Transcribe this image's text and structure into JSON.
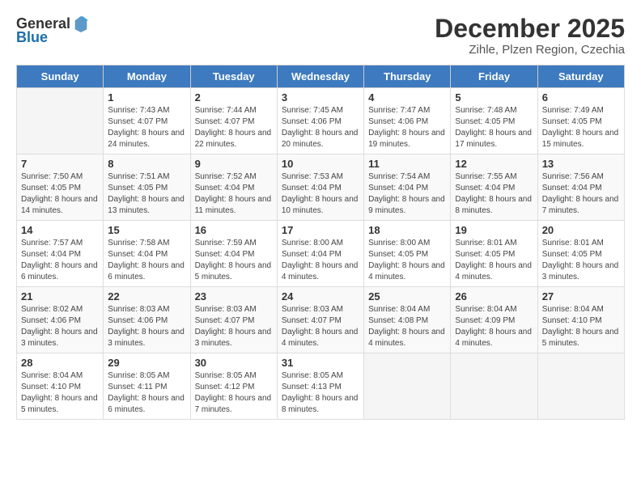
{
  "header": {
    "logo_general": "General",
    "logo_blue": "Blue",
    "month": "December 2025",
    "location": "Zihle, Plzen Region, Czechia"
  },
  "weekdays": [
    "Sunday",
    "Monday",
    "Tuesday",
    "Wednesday",
    "Thursday",
    "Friday",
    "Saturday"
  ],
  "weeks": [
    [
      {
        "day": "",
        "sunrise": "",
        "sunset": "",
        "daylight": ""
      },
      {
        "day": "1",
        "sunrise": "Sunrise: 7:43 AM",
        "sunset": "Sunset: 4:07 PM",
        "daylight": "Daylight: 8 hours and 24 minutes."
      },
      {
        "day": "2",
        "sunrise": "Sunrise: 7:44 AM",
        "sunset": "Sunset: 4:07 PM",
        "daylight": "Daylight: 8 hours and 22 minutes."
      },
      {
        "day": "3",
        "sunrise": "Sunrise: 7:45 AM",
        "sunset": "Sunset: 4:06 PM",
        "daylight": "Daylight: 8 hours and 20 minutes."
      },
      {
        "day": "4",
        "sunrise": "Sunrise: 7:47 AM",
        "sunset": "Sunset: 4:06 PM",
        "daylight": "Daylight: 8 hours and 19 minutes."
      },
      {
        "day": "5",
        "sunrise": "Sunrise: 7:48 AM",
        "sunset": "Sunset: 4:05 PM",
        "daylight": "Daylight: 8 hours and 17 minutes."
      },
      {
        "day": "6",
        "sunrise": "Sunrise: 7:49 AM",
        "sunset": "Sunset: 4:05 PM",
        "daylight": "Daylight: 8 hours and 15 minutes."
      }
    ],
    [
      {
        "day": "7",
        "sunrise": "Sunrise: 7:50 AM",
        "sunset": "Sunset: 4:05 PM",
        "daylight": "Daylight: 8 hours and 14 minutes."
      },
      {
        "day": "8",
        "sunrise": "Sunrise: 7:51 AM",
        "sunset": "Sunset: 4:05 PM",
        "daylight": "Daylight: 8 hours and 13 minutes."
      },
      {
        "day": "9",
        "sunrise": "Sunrise: 7:52 AM",
        "sunset": "Sunset: 4:04 PM",
        "daylight": "Daylight: 8 hours and 11 minutes."
      },
      {
        "day": "10",
        "sunrise": "Sunrise: 7:53 AM",
        "sunset": "Sunset: 4:04 PM",
        "daylight": "Daylight: 8 hours and 10 minutes."
      },
      {
        "day": "11",
        "sunrise": "Sunrise: 7:54 AM",
        "sunset": "Sunset: 4:04 PM",
        "daylight": "Daylight: 8 hours and 9 minutes."
      },
      {
        "day": "12",
        "sunrise": "Sunrise: 7:55 AM",
        "sunset": "Sunset: 4:04 PM",
        "daylight": "Daylight: 8 hours and 8 minutes."
      },
      {
        "day": "13",
        "sunrise": "Sunrise: 7:56 AM",
        "sunset": "Sunset: 4:04 PM",
        "daylight": "Daylight: 8 hours and 7 minutes."
      }
    ],
    [
      {
        "day": "14",
        "sunrise": "Sunrise: 7:57 AM",
        "sunset": "Sunset: 4:04 PM",
        "daylight": "Daylight: 8 hours and 6 minutes."
      },
      {
        "day": "15",
        "sunrise": "Sunrise: 7:58 AM",
        "sunset": "Sunset: 4:04 PM",
        "daylight": "Daylight: 8 hours and 6 minutes."
      },
      {
        "day": "16",
        "sunrise": "Sunrise: 7:59 AM",
        "sunset": "Sunset: 4:04 PM",
        "daylight": "Daylight: 8 hours and 5 minutes."
      },
      {
        "day": "17",
        "sunrise": "Sunrise: 8:00 AM",
        "sunset": "Sunset: 4:04 PM",
        "daylight": "Daylight: 8 hours and 4 minutes."
      },
      {
        "day": "18",
        "sunrise": "Sunrise: 8:00 AM",
        "sunset": "Sunset: 4:05 PM",
        "daylight": "Daylight: 8 hours and 4 minutes."
      },
      {
        "day": "19",
        "sunrise": "Sunrise: 8:01 AM",
        "sunset": "Sunset: 4:05 PM",
        "daylight": "Daylight: 8 hours and 4 minutes."
      },
      {
        "day": "20",
        "sunrise": "Sunrise: 8:01 AM",
        "sunset": "Sunset: 4:05 PM",
        "daylight": "Daylight: 8 hours and 3 minutes."
      }
    ],
    [
      {
        "day": "21",
        "sunrise": "Sunrise: 8:02 AM",
        "sunset": "Sunset: 4:06 PM",
        "daylight": "Daylight: 8 hours and 3 minutes."
      },
      {
        "day": "22",
        "sunrise": "Sunrise: 8:03 AM",
        "sunset": "Sunset: 4:06 PM",
        "daylight": "Daylight: 8 hours and 3 minutes."
      },
      {
        "day": "23",
        "sunrise": "Sunrise: 8:03 AM",
        "sunset": "Sunset: 4:07 PM",
        "daylight": "Daylight: 8 hours and 3 minutes."
      },
      {
        "day": "24",
        "sunrise": "Sunrise: 8:03 AM",
        "sunset": "Sunset: 4:07 PM",
        "daylight": "Daylight: 8 hours and 4 minutes."
      },
      {
        "day": "25",
        "sunrise": "Sunrise: 8:04 AM",
        "sunset": "Sunset: 4:08 PM",
        "daylight": "Daylight: 8 hours and 4 minutes."
      },
      {
        "day": "26",
        "sunrise": "Sunrise: 8:04 AM",
        "sunset": "Sunset: 4:09 PM",
        "daylight": "Daylight: 8 hours and 4 minutes."
      },
      {
        "day": "27",
        "sunrise": "Sunrise: 8:04 AM",
        "sunset": "Sunset: 4:10 PM",
        "daylight": "Daylight: 8 hours and 5 minutes."
      }
    ],
    [
      {
        "day": "28",
        "sunrise": "Sunrise: 8:04 AM",
        "sunset": "Sunset: 4:10 PM",
        "daylight": "Daylight: 8 hours and 5 minutes."
      },
      {
        "day": "29",
        "sunrise": "Sunrise: 8:05 AM",
        "sunset": "Sunset: 4:11 PM",
        "daylight": "Daylight: 8 hours and 6 minutes."
      },
      {
        "day": "30",
        "sunrise": "Sunrise: 8:05 AM",
        "sunset": "Sunset: 4:12 PM",
        "daylight": "Daylight: 8 hours and 7 minutes."
      },
      {
        "day": "31",
        "sunrise": "Sunrise: 8:05 AM",
        "sunset": "Sunset: 4:13 PM",
        "daylight": "Daylight: 8 hours and 8 minutes."
      },
      {
        "day": "",
        "sunrise": "",
        "sunset": "",
        "daylight": ""
      },
      {
        "day": "",
        "sunrise": "",
        "sunset": "",
        "daylight": ""
      },
      {
        "day": "",
        "sunrise": "",
        "sunset": "",
        "daylight": ""
      }
    ]
  ]
}
